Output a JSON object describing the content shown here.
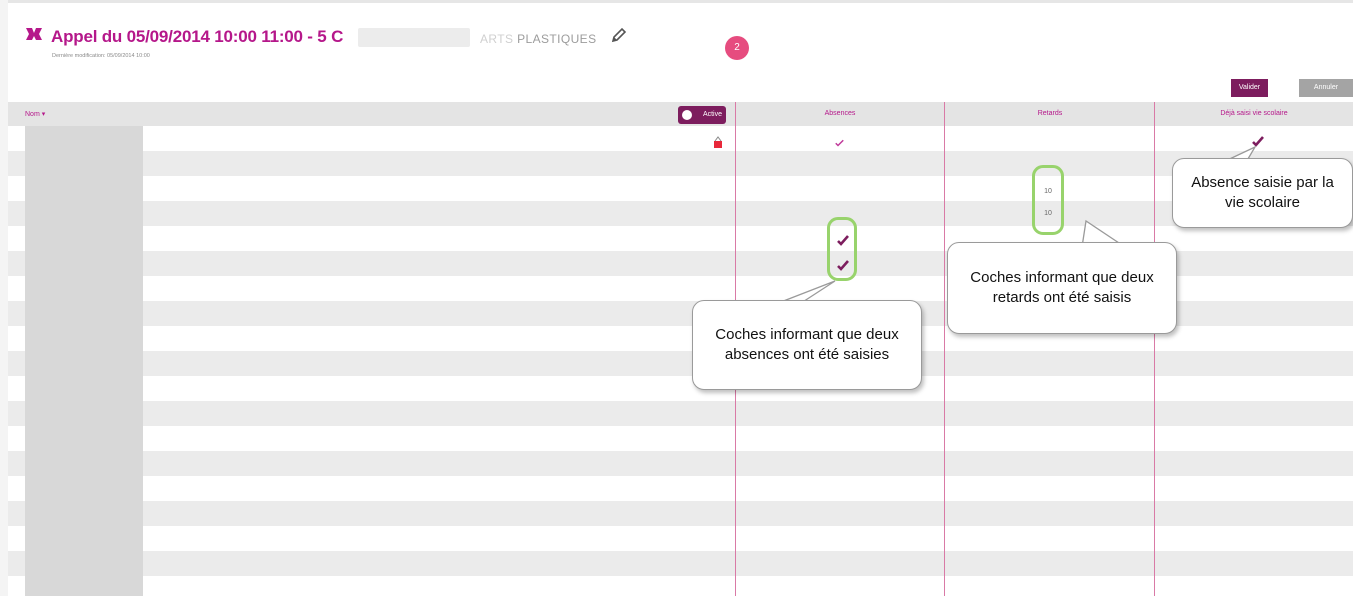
{
  "header": {
    "title": "Appel du 05/09/2014 10:00 11:00 - 5 C",
    "subject": "PLASTIQUES",
    "subject_blur": "ARTS",
    "subtitle": "Dernière modification: 05/09/2014 10:00",
    "step_number": "2"
  },
  "actions": {
    "validate_label": "Valider",
    "cancel_label": "Annuler"
  },
  "table": {
    "sort_label": "Nom ▾",
    "active_label": "Active",
    "columns": [
      "Absences",
      "Retards",
      "Déjà saisi vie scolaire"
    ],
    "late_counts": [
      "10",
      "10"
    ]
  },
  "callouts": {
    "absences": "Coches informant que deux absences ont été saisies",
    "retards": "Coches informant que deux retards ont été saisis",
    "vie_scolaire": "Absence saisie par la vie scolaire"
  },
  "colors": {
    "accent": "#b5178a",
    "dark_accent": "#7d1d5e",
    "highlight_ring": "#98d36c",
    "badge": "#e64c7f"
  }
}
